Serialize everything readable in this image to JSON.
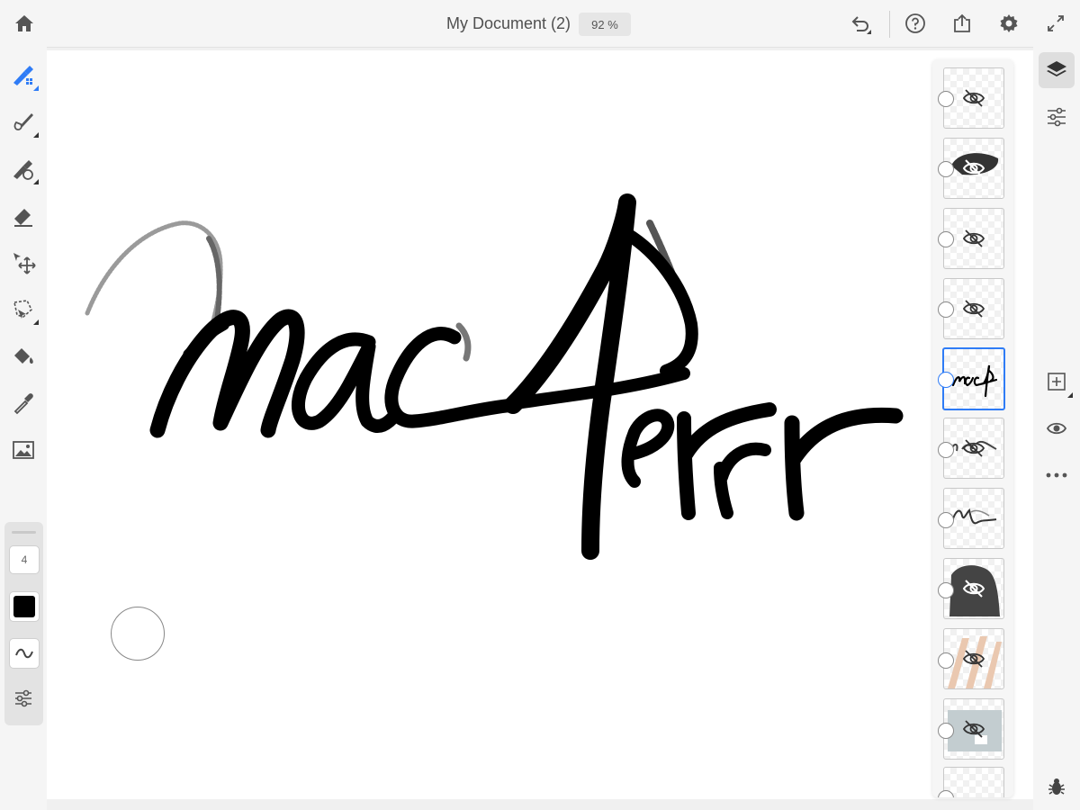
{
  "header": {
    "document_title": "My Document (2)",
    "zoom_level": "92 %",
    "icons": [
      "home-icon",
      "undo-icon",
      "help-icon",
      "share-icon",
      "settings-icon",
      "fullscreen-icon"
    ]
  },
  "tools": {
    "items": [
      "pixel-brush-icon",
      "live-brush-icon",
      "mixer-brush-icon",
      "eraser-icon",
      "move-transform-icon",
      "lasso-icon",
      "fill-icon",
      "eyedropper-icon",
      "image-icon"
    ],
    "current_color": "#000000"
  },
  "brush_panel": {
    "size": "4",
    "swatch_color": "#000000",
    "icons": [
      "flow-icon",
      "brush-settings-icon"
    ]
  },
  "layers_panel": {
    "selected_index": 4,
    "layer_count": 11
  },
  "right_rail": {
    "icons": [
      "layers-icon",
      "properties-icon",
      "add-layer-icon",
      "visibility-icon",
      "more-icon",
      "bug-icon"
    ]
  },
  "colors": {
    "accent": "#2f7cf6",
    "ink": "#000000",
    "layer_skin": "#eac8b0",
    "layer_bluegray": "#c3cdd0"
  }
}
